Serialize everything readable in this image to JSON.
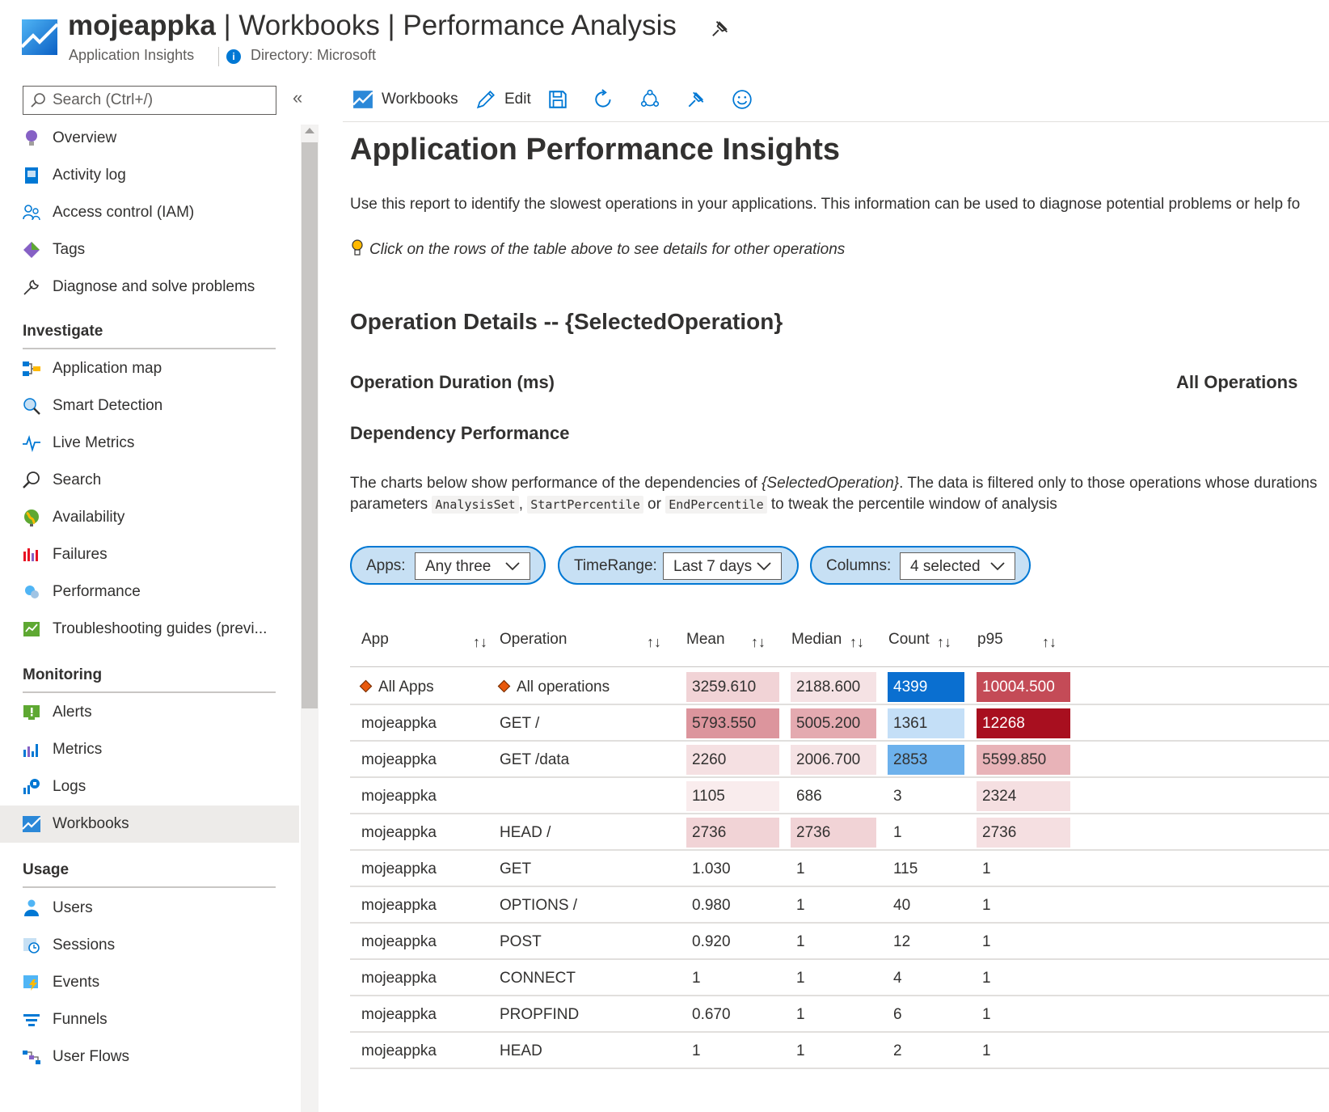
{
  "header": {
    "app_name": "mojeappka",
    "title_rest": " | Workbooks | Performance Analysis",
    "subtitle": "Application Insights",
    "directory": "Directory: Microsoft"
  },
  "sidebar": {
    "search_placeholder": "Search (Ctrl+/)",
    "collapse_glyph": "«",
    "items_top": [
      {
        "label": "Overview",
        "icon": "lightbulb-icon"
      },
      {
        "label": "Activity log",
        "icon": "activity-log-icon"
      },
      {
        "label": "Access control (IAM)",
        "icon": "people-icon"
      },
      {
        "label": "Tags",
        "icon": "tag-icon"
      },
      {
        "label": "Diagnose and solve problems",
        "icon": "wrench-icon"
      }
    ],
    "sections": [
      {
        "title": "Investigate",
        "items": [
          {
            "label": "Application map",
            "icon": "app-map-icon"
          },
          {
            "label": "Smart Detection",
            "icon": "smart-detection-icon"
          },
          {
            "label": "Live Metrics",
            "icon": "pulse-icon"
          },
          {
            "label": "Search",
            "icon": "search-icon"
          },
          {
            "label": "Availability",
            "icon": "globe-icon"
          },
          {
            "label": "Failures",
            "icon": "failures-icon"
          },
          {
            "label": "Performance",
            "icon": "performance-icon"
          },
          {
            "label": "Troubleshooting guides (previ...",
            "icon": "guide-icon"
          }
        ]
      },
      {
        "title": "Monitoring",
        "items": [
          {
            "label": "Alerts",
            "icon": "alert-icon"
          },
          {
            "label": "Metrics",
            "icon": "metrics-icon"
          },
          {
            "label": "Logs",
            "icon": "logs-icon"
          },
          {
            "label": "Workbooks",
            "icon": "workbooks-icon",
            "active": true
          }
        ]
      },
      {
        "title": "Usage",
        "items": [
          {
            "label": "Users",
            "icon": "user-icon"
          },
          {
            "label": "Sessions",
            "icon": "sessions-icon"
          },
          {
            "label": "Events",
            "icon": "events-icon"
          },
          {
            "label": "Funnels",
            "icon": "funnel-icon"
          },
          {
            "label": "User Flows",
            "icon": "user-flows-icon"
          }
        ]
      }
    ]
  },
  "toolbar": {
    "workbooks_label": "Workbooks",
    "edit_label": "Edit"
  },
  "main": {
    "title": "Application Performance Insights",
    "description": "Use this report to identify the slowest operations in your applications. This information can be used to diagnose potential problems or help fo",
    "tip": "Click on the rows of the table above to see details for other operations",
    "operation_details": "Operation Details -- {SelectedOperation}",
    "operation_duration": "Operation Duration (ms)",
    "all_operations": "All Operations",
    "dependency_performance": "Dependency Performance",
    "para1_a": "The charts below show performance of the dependencies of ",
    "para1_em": "{SelectedOperation}",
    "para1_b": ". The data is filtered only to those operations whose durations",
    "para2_a": "parameters ",
    "para2_code1": "AnalysisSet",
    "para2_comma": ", ",
    "para2_code2": "StartPercentile",
    "para2_or": " or ",
    "para2_code3": "EndPercentile",
    "para2_b": " to tweak the percentile window of analysis"
  },
  "filters": {
    "apps_label": "Apps:",
    "apps_value": "Any three",
    "timerange_label": "TimeRange:",
    "timerange_value": "Last 7 days",
    "columns_label": "Columns:",
    "columns_value": "4 selected"
  },
  "table": {
    "columns": [
      "App",
      "Operation",
      "Mean",
      "Median",
      "Count",
      "p95"
    ],
    "sort_glyph": "↑↓",
    "rows": [
      {
        "app": "All Apps",
        "operation": "All operations",
        "mean": "3259.610",
        "median": "2188.600",
        "count": "4399",
        "p95": "10004.500",
        "diamond": true
      },
      {
        "app": "mojeappka",
        "operation": "GET /",
        "mean": "5793.550",
        "median": "5005.200",
        "count": "1361",
        "p95": "12268"
      },
      {
        "app": "mojeappka",
        "operation": "GET /data",
        "mean": "2260",
        "median": "2006.700",
        "count": "2853",
        "p95": "5599.850"
      },
      {
        "app": "mojeappka",
        "operation": "",
        "mean": "1105",
        "median": "686",
        "count": "3",
        "p95": "2324"
      },
      {
        "app": "mojeappka",
        "operation": "HEAD /",
        "mean": "2736",
        "median": "2736",
        "count": "1",
        "p95": "2736"
      },
      {
        "app": "mojeappka",
        "operation": "GET",
        "mean": "1.030",
        "median": "1",
        "count": "115",
        "p95": "1"
      },
      {
        "app": "mojeappka",
        "operation": "OPTIONS /",
        "mean": "0.980",
        "median": "1",
        "count": "40",
        "p95": "1"
      },
      {
        "app": "mojeappka",
        "operation": "POST",
        "mean": "0.920",
        "median": "1",
        "count": "12",
        "p95": "1"
      },
      {
        "app": "mojeappka",
        "operation": "CONNECT",
        "mean": "1",
        "median": "1",
        "count": "4",
        "p95": "1"
      },
      {
        "app": "mojeappka",
        "operation": "PROPFIND",
        "mean": "0.670",
        "median": "1",
        "count": "6",
        "p95": "1"
      },
      {
        "app": "mojeappka",
        "operation": "HEAD",
        "mean": "1",
        "median": "1",
        "count": "2",
        "p95": "1"
      }
    ],
    "heat_colors": {
      "mean": [
        "#f1d3d6",
        "#dc959d",
        "#f5e0e2",
        "#f9eced",
        "#f1d3d6"
      ],
      "median": [
        "#f5e2e4",
        "#e4aab0",
        "#f5e2e4",
        null,
        "#f1d3d6"
      ],
      "count": [
        "#0a6fd0",
        "#c4dff7",
        "#6db1ec",
        null,
        null
      ],
      "p95": [
        "#c44b57",
        "#a80f1f",
        "#e8b3b8",
        "#f5dfe1",
        "#f5dfe1"
      ]
    },
    "heat_text_white": {
      "p95": [
        true,
        true,
        false,
        false,
        false
      ]
    }
  }
}
